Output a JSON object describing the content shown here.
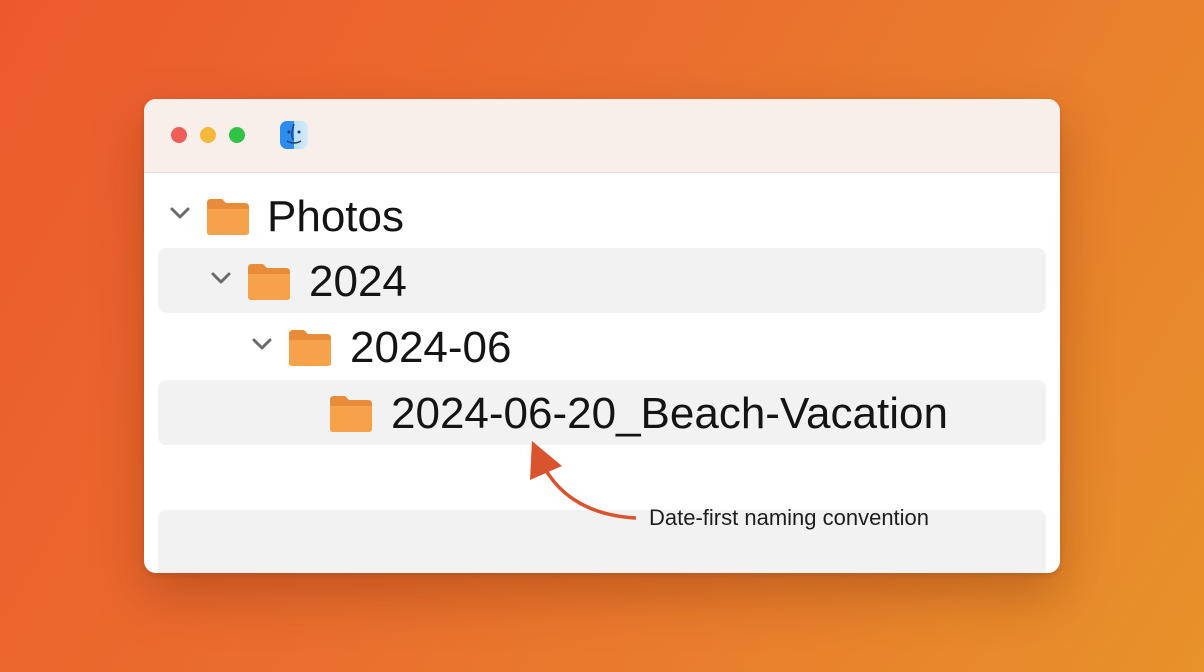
{
  "window": {
    "controls": {
      "close_icon": "close-button",
      "minimize_icon": "minimize-button",
      "maximize_icon": "maximize-button"
    },
    "app_icon": "finder-icon"
  },
  "tree": {
    "items": [
      {
        "label": "Photos",
        "expanded": true,
        "level": 0,
        "highlighted": false
      },
      {
        "label": "2024",
        "expanded": true,
        "level": 1,
        "highlighted": true
      },
      {
        "label": "2024-06",
        "expanded": true,
        "level": 2,
        "highlighted": false
      },
      {
        "label": "2024-06-20_Beach-Vacation",
        "expanded": false,
        "level": 3,
        "highlighted": true
      }
    ]
  },
  "annotation": {
    "text": "Date-first naming convention",
    "color": "#d9542c"
  },
  "colors": {
    "background_start": "#ec5a2c",
    "background_end": "#e7922a",
    "folder": "#f6a24a",
    "titlebar": "#f8efea"
  }
}
